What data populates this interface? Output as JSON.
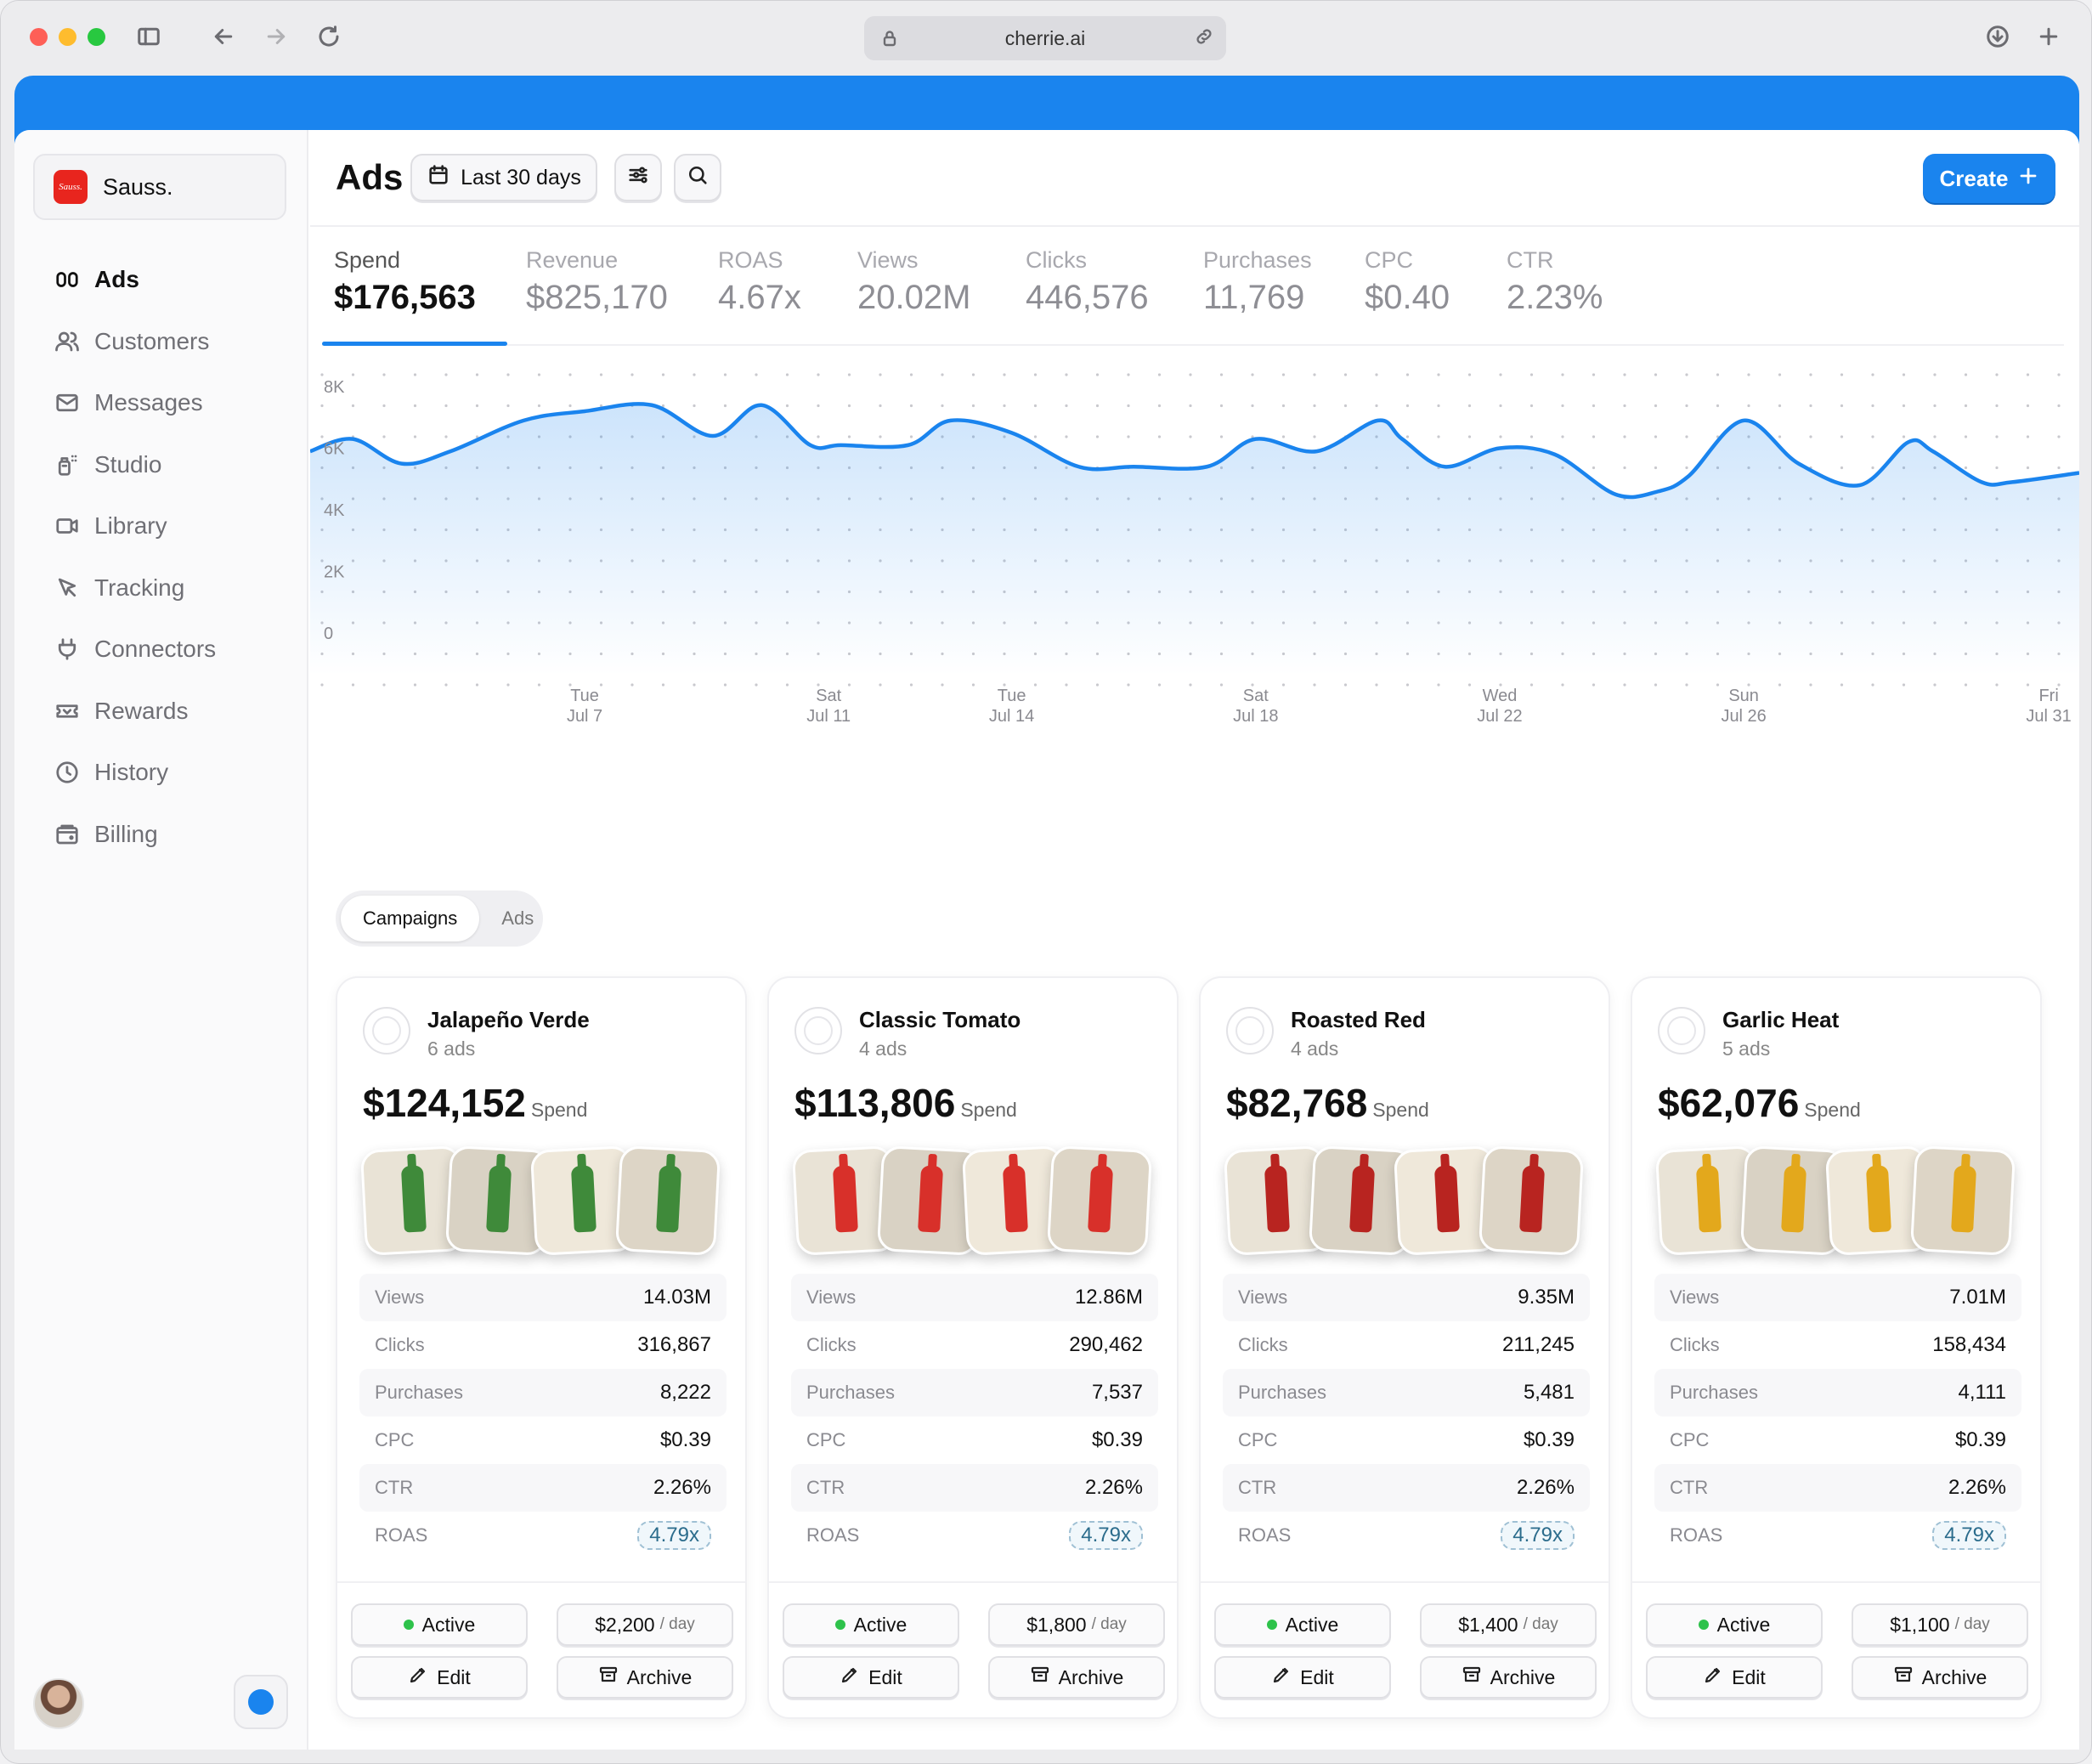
{
  "browser": {
    "url": "cherrie.ai"
  },
  "brand": {
    "name": "Sauss.",
    "logo_text": "Sauss."
  },
  "sidebar": {
    "items": [
      {
        "label": "Ads",
        "icon": "ads-icon",
        "active": true
      },
      {
        "label": "Customers",
        "icon": "users-icon",
        "active": false
      },
      {
        "label": "Messages",
        "icon": "mail-icon",
        "active": false
      },
      {
        "label": "Studio",
        "icon": "studio-icon",
        "active": false
      },
      {
        "label": "Library",
        "icon": "video-icon",
        "active": false
      },
      {
        "label": "Tracking",
        "icon": "cursor-icon",
        "active": false
      },
      {
        "label": "Connectors",
        "icon": "plug-icon",
        "active": false
      },
      {
        "label": "Rewards",
        "icon": "ticket-icon",
        "active": false
      },
      {
        "label": "History",
        "icon": "clock-icon",
        "active": false
      },
      {
        "label": "Billing",
        "icon": "wallet-icon",
        "active": false
      }
    ]
  },
  "header": {
    "title": "Ads",
    "date_range": "Last 30 days",
    "create_label": "Create"
  },
  "metrics": [
    {
      "label": "Spend",
      "value": "$176,563",
      "active": true
    },
    {
      "label": "Revenue",
      "value": "$825,170",
      "active": false
    },
    {
      "label": "ROAS",
      "value": "4.67x",
      "active": false
    },
    {
      "label": "Views",
      "value": "20.02M",
      "active": false
    },
    {
      "label": "Clicks",
      "value": "446,576",
      "active": false
    },
    {
      "label": "Purchases",
      "value": "11,769",
      "active": false
    },
    {
      "label": "CPC",
      "value": "$0.40",
      "active": false
    },
    {
      "label": "CTR",
      "value": "2.23%",
      "active": false
    }
  ],
  "chart_data": {
    "type": "area",
    "ylabel": "",
    "xlabel": "",
    "ylim": [
      0,
      8000
    ],
    "y_ticks": [
      "0",
      "2K",
      "4K",
      "6K",
      "8K"
    ],
    "y_tick_values": [
      0,
      2000,
      4000,
      6000,
      8000
    ],
    "x_ticks": [
      {
        "day": "Tue",
        "date": "Jul 7",
        "x": 7
      },
      {
        "day": "Sat",
        "date": "Jul 11",
        "x": 11
      },
      {
        "day": "Tue",
        "date": "Jul 14",
        "x": 14
      },
      {
        "day": "Sat",
        "date": "Jul 18",
        "x": 18
      },
      {
        "day": "Wed",
        "date": "Jul 22",
        "x": 22
      },
      {
        "day": "Sun",
        "date": "Jul 26",
        "x": 26
      },
      {
        "day": "Fri",
        "date": "Jul 31",
        "x": 31
      }
    ],
    "xlim": [
      2.5,
      31.5
    ],
    "grid": "dotted",
    "color": "#1a84ee",
    "series": [
      {
        "x": [
          2.5,
          3.2,
          4.0,
          4.8,
          6.0,
          7.0,
          8.1,
          9.1,
          9.9,
          10.7,
          11.2,
          12.3,
          13.0,
          14.0,
          15.1,
          16.0,
          17.2,
          18.0,
          19.0,
          20.0,
          20.4,
          21.1,
          22.0,
          22.9,
          23.9,
          24.6,
          25.1,
          26.0,
          26.9,
          27.9,
          28.7,
          29.1,
          29.9,
          30.4,
          31.5
        ],
        "y": [
          5900,
          6300,
          5500,
          5900,
          6900,
          7200,
          7400,
          6400,
          7400,
          6100,
          6100,
          6100,
          6900,
          6500,
          5400,
          5400,
          5400,
          6300,
          5900,
          6900,
          6300,
          5400,
          6000,
          5800,
          4500,
          4600,
          5100,
          6900,
          5500,
          4800,
          6200,
          5900,
          4900,
          4900,
          5200
        ]
      }
    ]
  },
  "segment": {
    "items": [
      "Campaigns",
      "Ads"
    ],
    "active": "Campaigns"
  },
  "stat_labels": [
    "Views",
    "Clicks",
    "Purchases",
    "CPC",
    "CTR",
    "ROAS"
  ],
  "spend_label": "Spend",
  "campaigns": [
    {
      "name": "Jalapeño Verde",
      "ads": "6 ads",
      "spend": "$124,152",
      "color": "#3f8a3a",
      "stats": [
        "14.03M",
        "316,867",
        "8,222",
        "$0.39",
        "2.26%",
        "4.79x"
      ],
      "status": "Active",
      "budget": "$2,200",
      "per_day": "/ day",
      "edit": "Edit",
      "archive": "Archive"
    },
    {
      "name": "Classic Tomato",
      "ads": "4 ads",
      "spend": "$113,806",
      "color": "#d8302a",
      "stats": [
        "12.86M",
        "290,462",
        "7,537",
        "$0.39",
        "2.26%",
        "4.79x"
      ],
      "status": "Active",
      "budget": "$1,800",
      "per_day": "/ day",
      "edit": "Edit",
      "archive": "Archive"
    },
    {
      "name": "Roasted Red",
      "ads": "4 ads",
      "spend": "$82,768",
      "color": "#b82420",
      "stats": [
        "9.35M",
        "211,245",
        "5,481",
        "$0.39",
        "2.26%",
        "4.79x"
      ],
      "status": "Active",
      "budget": "$1,400",
      "per_day": "/ day",
      "edit": "Edit",
      "archive": "Archive"
    },
    {
      "name": "Garlic Heat",
      "ads": "5 ads",
      "spend": "$62,076",
      "color": "#e3a81c",
      "stats": [
        "7.01M",
        "158,434",
        "4,111",
        "$0.39",
        "2.26%",
        "4.79x"
      ],
      "status": "Active",
      "budget": "$1,100",
      "per_day": "/ day",
      "edit": "Edit",
      "archive": "Archive"
    }
  ]
}
